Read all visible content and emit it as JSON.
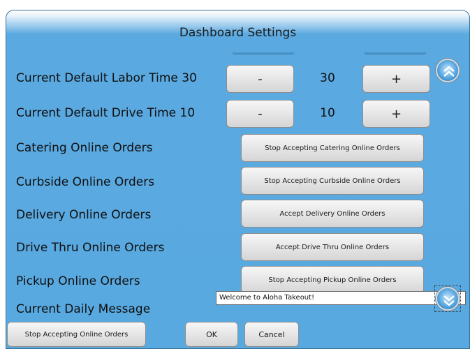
{
  "dialog": {
    "title": "Dashboard Settings"
  },
  "labor": {
    "label": "Current Default Labor Time 30",
    "minus": "-",
    "value": "30",
    "plus": "+"
  },
  "drive": {
    "label": "Current Default Drive Time 10",
    "minus": "-",
    "value": "10",
    "plus": "+"
  },
  "orders": [
    {
      "label": "Catering Online Orders",
      "button": "Stop Accepting Catering Online Orders"
    },
    {
      "label": "Curbside Online Orders",
      "button": "Stop Accepting Curbside Online Orders"
    },
    {
      "label": "Delivery Online Orders",
      "button": "Accept Delivery Online Orders"
    },
    {
      "label": "Drive Thru Online Orders",
      "button": "Accept Drive Thru Online Orders"
    },
    {
      "label": "Pickup Online Orders",
      "button": "Stop Accepting Pickup Online Orders"
    }
  ],
  "message": {
    "label": "Current Daily Message",
    "value": "Welcome to Aloha Takeout!"
  },
  "footer": {
    "stop_all": "Stop Accepting Online Orders",
    "ok": "OK",
    "cancel": "Cancel"
  },
  "icons": {
    "scroll_up": "double-chevron-up-icon",
    "scroll_down": "double-chevron-down-icon"
  },
  "colors": {
    "panel": "#59a9e1",
    "button": "#e6e6e6"
  }
}
